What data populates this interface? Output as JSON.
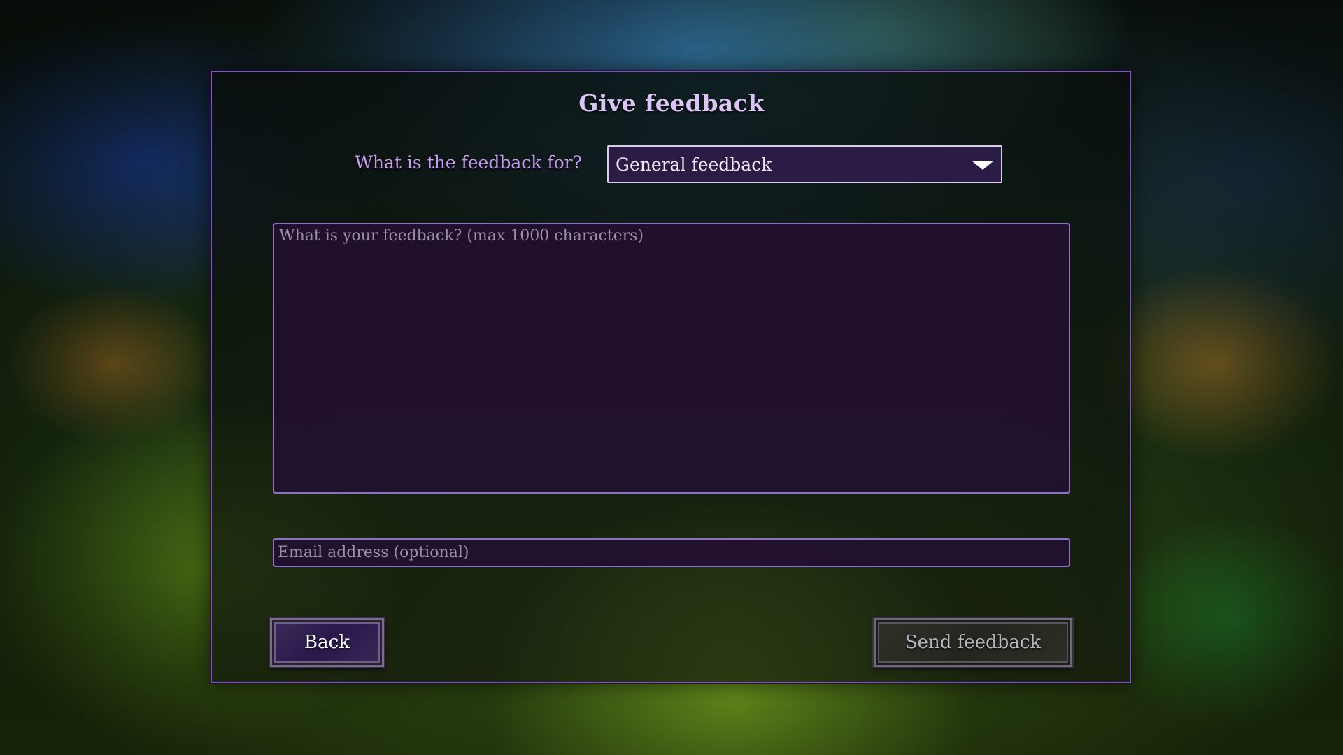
{
  "dialog": {
    "title": "Give feedback",
    "category_label": "What is the feedback for?",
    "category_selected": "General feedback",
    "feedback_placeholder": "What is your feedback? (max 1000 characters)",
    "feedback_value": "",
    "email_placeholder": "Email address (optional)",
    "email_value": "",
    "back_label": "Back",
    "send_label": "Send feedback"
  },
  "colors": {
    "accent": "#c89df2",
    "panel_border": "#7d58b0",
    "input_bg": "#21112d",
    "dropdown_bg": "#2b1c45",
    "placeholder_text": "#9a8eac"
  },
  "icons": {
    "dropdown": "chevron-down-icon"
  }
}
